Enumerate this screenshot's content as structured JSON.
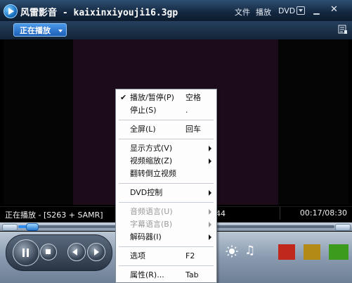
{
  "window": {
    "app_title": "风雷影音",
    "file_name": "kaixinxiyouji16.3gp",
    "title_separator": "-",
    "menus": [
      "文件",
      "播放",
      "DVD"
    ],
    "icons": [
      "app-logo-icon",
      "dropdown-icon",
      "minimize-icon",
      "close-icon",
      "playlist-icon"
    ]
  },
  "tab": {
    "label": "正在播放"
  },
  "status": {
    "left_text": "正在播放 - [S263 + SAMR]",
    "mid_text": "44",
    "time": "00:17/08:30"
  },
  "seek": {
    "progress_fraction": 0.034
  },
  "colors": {
    "swatches": [
      "#c0281c",
      "#b38a16",
      "#3c9a1c"
    ]
  },
  "context_menu": {
    "items": [
      {
        "label": "播放/暂停(P)",
        "shortcut": "空格",
        "checked": true,
        "submenu": false,
        "disabled": false
      },
      {
        "label": "停止(S)",
        "shortcut": ".",
        "checked": false,
        "submenu": false,
        "disabled": false
      },
      {
        "label": "全屏(L)",
        "shortcut": "回车",
        "checked": false,
        "submenu": false,
        "disabled": false
      },
      {
        "label": "显示方式(V)",
        "shortcut": "",
        "checked": false,
        "submenu": true,
        "disabled": false
      },
      {
        "label": "视频缩放(Z)",
        "shortcut": "",
        "checked": false,
        "submenu": true,
        "disabled": false
      },
      {
        "label": "翻转倒立视频",
        "shortcut": "",
        "checked": false,
        "submenu": false,
        "disabled": false
      },
      {
        "label": "DVD控制",
        "shortcut": "",
        "checked": false,
        "submenu": true,
        "disabled": false
      },
      {
        "label": "音频语言(U)",
        "shortcut": "",
        "checked": false,
        "submenu": true,
        "disabled": true
      },
      {
        "label": "字幕语言(B)",
        "shortcut": "",
        "checked": false,
        "submenu": true,
        "disabled": true
      },
      {
        "label": "解码器(I)",
        "shortcut": "",
        "checked": false,
        "submenu": true,
        "disabled": false
      },
      {
        "label": "选项",
        "shortcut": "F2",
        "checked": false,
        "submenu": false,
        "disabled": false
      },
      {
        "label": "属性(R)...",
        "shortcut": "Tab",
        "checked": false,
        "submenu": false,
        "disabled": false
      }
    ]
  }
}
